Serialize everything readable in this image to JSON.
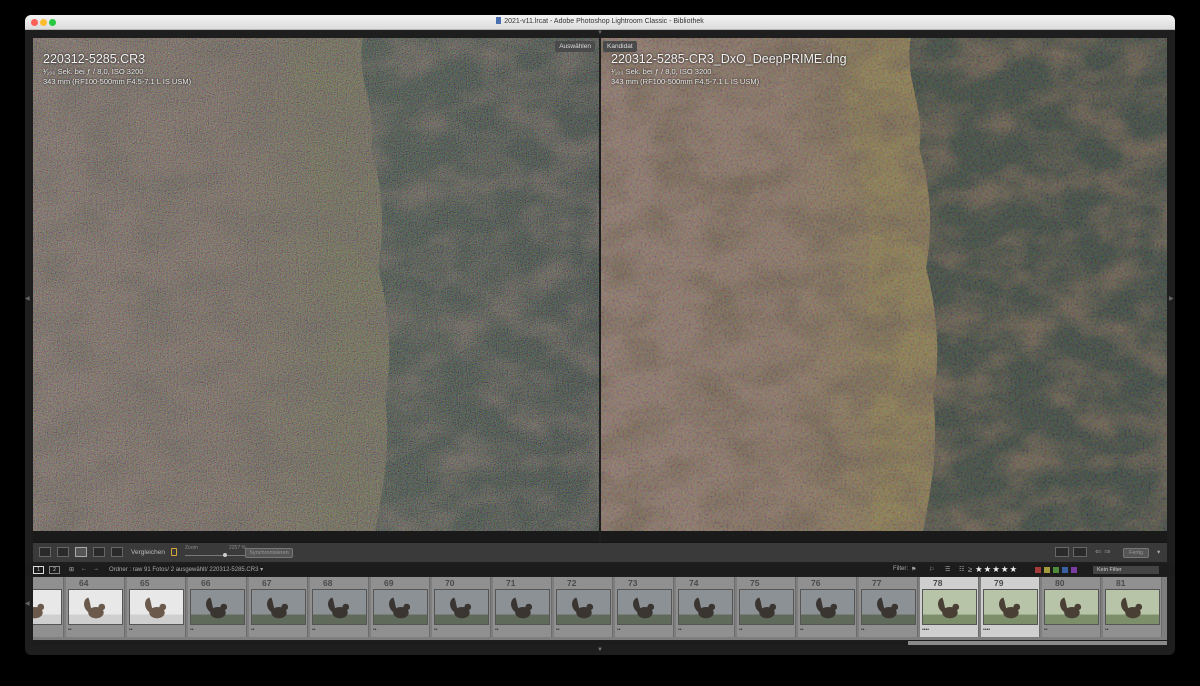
{
  "window": {
    "title": "2021-v11.lrcat - Adobe Photoshop Lightroom Classic - Bibliothek"
  },
  "compare": {
    "select_label": "Auswählen",
    "candidate_label": "Kandidat",
    "left": {
      "filename": "220312-5285.CR3",
      "exposure": "¹⁄₁₀₀ Sek. bei ƒ / 8,0, ISO 3200",
      "lens": "343 mm (RF100-500mm F4.5-7.1 L IS USM)",
      "stars": "★★★★"
    },
    "right": {
      "filename": "220312-5285-CR3_DxO_DeepPRIME.dng",
      "exposure": "¹⁄₁₀₀ Sek. bei ƒ / 8,0, ISO 3200",
      "lens": "343 mm (RF100-500mm F4.5-7.1 L IS USM)",
      "stars": "★★★★"
    }
  },
  "toolbar": {
    "compare_label": "Vergleichen",
    "zoom_label": "Zoom",
    "zoom_value": "2257 %",
    "sync_label": "Synchronisieren",
    "done_label": "Fertig"
  },
  "filmstrip_header": {
    "screen1": "1",
    "screen2": "2",
    "path": "Ordner : raw   91 Fotos/ 2 ausgewählt/ 220312-5285.CR3 ▾",
    "filter_label": "Filter:",
    "rating_op": "≥",
    "rating_stars": "★★★★★",
    "filter_value": "Kein Filter",
    "label_colors": [
      "#a33b3b",
      "#a39a3b",
      "#4e8a3b",
      "#3b5fa3",
      "#7a3ba3"
    ]
  },
  "filmstrip": {
    "items": [
      {
        "num": "",
        "dots": "",
        "scene": "white"
      },
      {
        "num": "64",
        "dots": "••",
        "scene": "white"
      },
      {
        "num": "65",
        "dots": "••",
        "scene": "white"
      },
      {
        "num": "66",
        "dots": "••",
        "scene": "grey"
      },
      {
        "num": "67",
        "dots": "••",
        "scene": "grey"
      },
      {
        "num": "68",
        "dots": "••",
        "scene": "grey"
      },
      {
        "num": "69",
        "dots": "••",
        "scene": "grey"
      },
      {
        "num": "70",
        "dots": "••",
        "scene": "grey"
      },
      {
        "num": "71",
        "dots": "••",
        "scene": "grey"
      },
      {
        "num": "72",
        "dots": "••",
        "scene": "grey"
      },
      {
        "num": "73",
        "dots": "••",
        "scene": "grey"
      },
      {
        "num": "74",
        "dots": "••",
        "scene": "grey"
      },
      {
        "num": "75",
        "dots": "••",
        "scene": "grey"
      },
      {
        "num": "76",
        "dots": "••",
        "scene": "grey"
      },
      {
        "num": "77",
        "dots": "••",
        "scene": "grey"
      },
      {
        "num": "78",
        "dots": "••••",
        "scene": "green",
        "selected": true
      },
      {
        "num": "79",
        "dots": "••••",
        "scene": "green",
        "selected": true
      },
      {
        "num": "80",
        "dots": "••",
        "scene": "green"
      },
      {
        "num": "81",
        "dots": "••",
        "scene": "green"
      }
    ]
  },
  "colors": {
    "background": "#000000",
    "panel": "#3a3a3a",
    "filmstrip": "#7e7e7e",
    "selected_cell": "#cfcfcf"
  }
}
